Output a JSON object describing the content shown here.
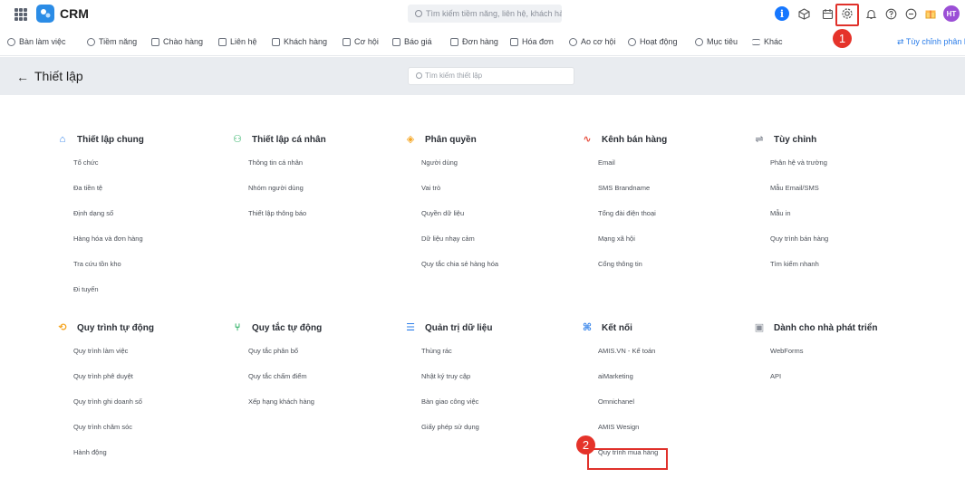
{
  "app": {
    "name": "CRM"
  },
  "global_search": {
    "placeholder": "Tìm kiếm tiềm năng, liên hệ, khách hàng"
  },
  "header_icons": {
    "avatar_initials": "HT"
  },
  "nav": {
    "items": [
      {
        "label": "Bàn làm việc",
        "icon": "home-icon"
      },
      {
        "label": "Tiềm năng",
        "icon": "target-icon"
      },
      {
        "label": "Chào hàng",
        "icon": "gift-icon"
      },
      {
        "label": "Liên hệ",
        "icon": "contact-icon"
      },
      {
        "label": "Khách hàng",
        "icon": "building-icon"
      },
      {
        "label": "Cơ hội",
        "icon": "folder-icon"
      },
      {
        "label": "Báo giá",
        "icon": "quote-icon"
      },
      {
        "label": "Đơn hàng",
        "icon": "cart-icon"
      },
      {
        "label": "Hóa đơn",
        "icon": "invoice-icon"
      },
      {
        "label": "Ao cơ hội",
        "icon": "funnel-icon"
      },
      {
        "label": "Hoạt động",
        "icon": "activity-icon"
      },
      {
        "label": "Mục tiêu",
        "icon": "goal-icon"
      },
      {
        "label": "Khác",
        "icon": "menu-icon"
      }
    ],
    "customize_label": "Tùy chỉnh phân hệ"
  },
  "subheader": {
    "title": "Thiết lập",
    "search_placeholder": "Tìm kiếm thiết lập"
  },
  "sections": [
    {
      "title": "Thiết lập chung",
      "icon": "bank-icon",
      "color": "#2b7de9",
      "links": [
        "Tổ chức",
        "Đa tiền tệ",
        "Định dạng số",
        "Hàng hóa và đơn hàng",
        "Tra cứu tồn kho",
        "Đi tuyến"
      ]
    },
    {
      "title": "Thiết lập cá nhân",
      "icon": "user-settings-icon",
      "color": "#27ae60",
      "links": [
        "Thông tin cá nhân",
        "Nhóm người dùng",
        "Thiết lập thông báo"
      ]
    },
    {
      "title": "Phân quyền",
      "icon": "shield-icon",
      "color": "#f5a623",
      "links": [
        "Người dùng",
        "Vai trò",
        "Quyền dữ liệu",
        "Dữ liệu nhạy cảm",
        "Quy tắc chia sẻ hàng hóa"
      ]
    },
    {
      "title": "Kênh bán hàng",
      "icon": "pulse-icon",
      "color": "#e74c3c",
      "links": [
        "Email",
        "SMS Brandname",
        "Tổng đài điện thoại",
        "Mạng xã hội",
        "Cổng thông tin"
      ]
    },
    {
      "title": "Tùy chỉnh",
      "icon": "sliders-icon",
      "color": "#8a8f99",
      "links": [
        "Phân hệ và trường",
        "Mẫu Email/SMS",
        "Mẫu in",
        "Quy trình bán hàng",
        "Tìm kiếm nhanh"
      ]
    },
    {
      "title": "Quy trình tự động",
      "icon": "cycle-icon",
      "color": "#f5a623",
      "links": [
        "Quy trình làm việc",
        "Quy trình phê duyệt",
        "Quy trình ghi doanh số",
        "Quy trình chăm sóc",
        "Hành động"
      ]
    },
    {
      "title": "Quy tắc tự động",
      "icon": "branch-icon",
      "color": "#27ae60",
      "links": [
        "Quy tắc phân bổ",
        "Quy tắc chấm điểm",
        "Xếp hạng khách hàng"
      ]
    },
    {
      "title": "Quản trị dữ liệu",
      "icon": "database-icon",
      "color": "#2b7de9",
      "links": [
        "Thùng rác",
        "Nhật ký truy cập",
        "Bàn giao công việc",
        "Giấy phép sử dụng"
      ]
    },
    {
      "title": "Kết nối",
      "icon": "command-icon",
      "color": "#2b7de9",
      "links": [
        "AMIS.VN - Kế toán",
        "aiMarketing",
        "Omnichanel",
        "AMIS Wesign",
        "Quy trình mua hàng"
      ]
    },
    {
      "title": "Dành cho nhà phát triển",
      "icon": "code-icon",
      "color": "#8a8f99",
      "links": [
        "WebForms",
        "API"
      ]
    }
  ],
  "annotations": {
    "step1": "1",
    "step2": "2",
    "accent": "#e0312b"
  }
}
